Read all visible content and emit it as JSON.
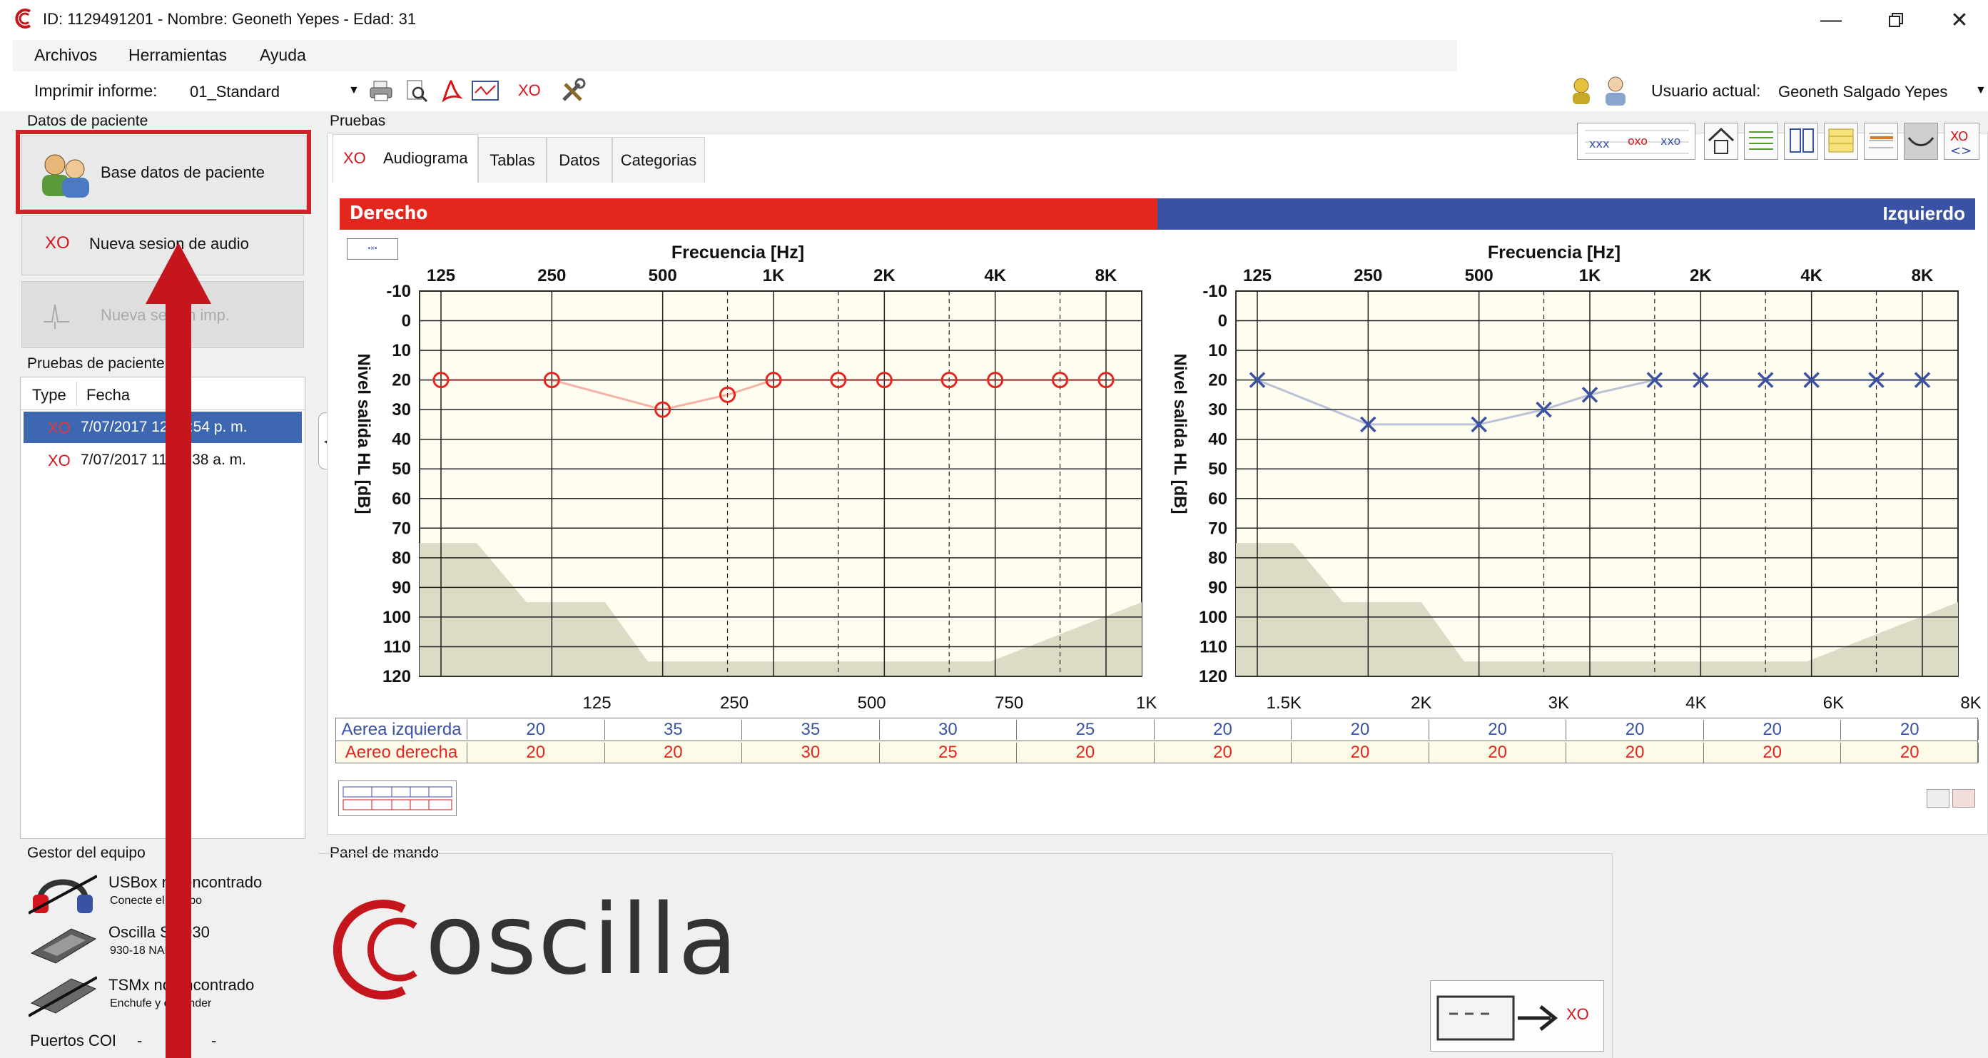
{
  "window": {
    "title": "ID: 1129491201  -  Nombre: Geoneth Yepes - Edad: 31"
  },
  "menu": {
    "items": [
      "Archivos",
      "Herramientas",
      "Ayuda"
    ]
  },
  "toolbar": {
    "print_label": "Imprimir informe:",
    "print_value": "01_Standard",
    "xo_label": "XO",
    "user_label": "Usuario actual:",
    "user_value": "Geoneth Salgado Yepes"
  },
  "patient": {
    "group_label": "Datos de paciente",
    "db_button": "Base datos de paciente",
    "new_audio_button": "Nueva sesion de audio",
    "new_imp_button": "Nueva sesion imp.",
    "xo_glyph": "XO"
  },
  "tests": {
    "group_label": "Pruebas de paciente",
    "columns": [
      "Type",
      "Fecha"
    ],
    "rows": [
      {
        "type": "XO",
        "date": "7/07/2017 12:09:54 p. m."
      },
      {
        "type": "XO",
        "date": "7/07/2017 11:58:38 a. m."
      }
    ]
  },
  "pruebas": {
    "group_label": "Pruebas",
    "tabs": [
      "Audiograma",
      "Tablas",
      "Datos",
      "Categorias"
    ],
    "xo_glyph": "XO"
  },
  "audiogram": {
    "right_label": "Derecho",
    "left_label": "Izquierdo",
    "freq_title": "Frecuencia [Hz]",
    "ylabel": "Nivel salida HL [dB]",
    "colors": {
      "right": "#e3261e",
      "left": "#3a52a4"
    }
  },
  "chart_data": [
    {
      "type": "line",
      "title": "Derecho",
      "xlabel": "Frecuencia [Hz]",
      "ylabel": "Nivel salida HL [dB]",
      "x_ticks": [
        "125",
        "250",
        "500",
        "1K",
        "2K",
        "4K",
        "8K"
      ],
      "y_ticks": [
        "-10",
        "0",
        "10",
        "20",
        "30",
        "40",
        "50",
        "60",
        "70",
        "80",
        "90",
        "100",
        "110",
        "120"
      ],
      "ylim": [
        -10,
        120
      ],
      "series": [
        {
          "x": [
            125,
            250,
            500,
            750,
            1000,
            1500,
            2000,
            3000,
            4000,
            6000,
            8000
          ],
          "y": [
            20,
            20,
            30,
            25,
            20,
            20,
            20,
            20,
            20,
            20,
            20
          ],
          "marker": "circle",
          "color": "#e3261e"
        }
      ]
    },
    {
      "type": "line",
      "title": "Izquierdo",
      "xlabel": "Frecuencia [Hz]",
      "ylabel": "Nivel salida HL [dB]",
      "x_ticks": [
        "125",
        "250",
        "500",
        "1K",
        "2K",
        "4K",
        "8K"
      ],
      "y_ticks": [
        "-10",
        "0",
        "10",
        "20",
        "30",
        "40",
        "50",
        "60",
        "70",
        "80",
        "90",
        "100",
        "110",
        "120"
      ],
      "ylim": [
        -10,
        120
      ],
      "series": [
        {
          "x": [
            125,
            250,
            500,
            750,
            1000,
            1500,
            2000,
            3000,
            4000,
            6000,
            8000
          ],
          "y": [
            20,
            35,
            35,
            30,
            25,
            20,
            20,
            20,
            20,
            20,
            20
          ],
          "marker": "x",
          "color": "#3a52a4"
        }
      ]
    }
  ],
  "freq_table": {
    "headers": [
      "125",
      "250",
      "500",
      "750",
      "1K",
      "1.5K",
      "2K",
      "3K",
      "4K",
      "6K",
      "8K"
    ],
    "rows": [
      {
        "label": "Aerea izquierda",
        "values": [
          "20",
          "35",
          "35",
          "30",
          "25",
          "20",
          "20",
          "20",
          "20",
          "20",
          "20"
        ],
        "color": "#3a52a4"
      },
      {
        "label": "Aereo derecha",
        "values": [
          "20",
          "20",
          "30",
          "25",
          "20",
          "20",
          "20",
          "20",
          "20",
          "20",
          "20"
        ],
        "color": "#e3261e"
      }
    ]
  },
  "devices": {
    "group_label": "Gestor del equipo",
    "items": [
      {
        "name": "USBox no encontrado",
        "sub": "Conecte el equipo"
      },
      {
        "name": "Oscilla SM930",
        "sub": "930-18 NAES"
      },
      {
        "name": "TSMx no encontrado",
        "sub": "Enchufe y encender"
      }
    ],
    "ports_label": "Puertos COI",
    "ports_value": "-",
    "ports_value2": "-"
  },
  "control": {
    "group_label": "Panel de mando",
    "logo_text": "oscilla",
    "xo_glyph": "XO"
  }
}
